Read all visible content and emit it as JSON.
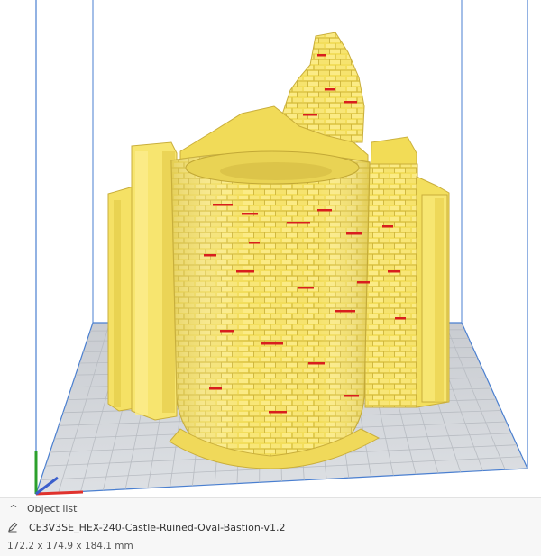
{
  "object_list": {
    "header_label": "Object list",
    "collapse_icon": "chevron-up-icon",
    "edit_icon": "pencil-icon",
    "object_name": "CE3V3SE_HEX-240-Castle-Ruined-Oval-Bastion-v1.2",
    "dimensions": "172.2 x 174.9 x 184.1 mm"
  },
  "viewport": {
    "build_volume_color": "#4a7fd0",
    "build_plate_color": "#d2d5d9",
    "grid_color": "#b8bcc2",
    "model_color": "#f5e36a",
    "overhang_color": "#d81e1e",
    "axis_colors": {
      "x": "#e0322d",
      "y": "#3b5fcc",
      "z": "#2ca02c"
    }
  }
}
